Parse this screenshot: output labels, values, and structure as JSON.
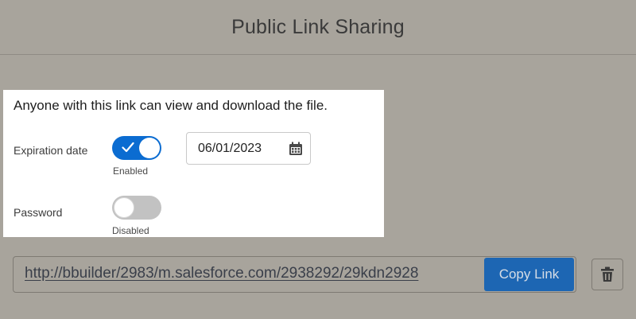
{
  "header": {
    "title": "Public Link Sharing"
  },
  "settings": {
    "intro": "Anyone with this link can view and download the file.",
    "expiration": {
      "label": "Expiration date",
      "enabled": true,
      "status": "Enabled",
      "date": "06/01/2023",
      "icon": "calendar-icon"
    },
    "password": {
      "label": "Password",
      "enabled": false,
      "status": "Disabled"
    }
  },
  "link": {
    "url": "http://bbuilder/2983/m.salesforce.com/2938292/29kdn2928",
    "copy_label": "Copy Link",
    "delete_icon": "trash-icon"
  },
  "colors": {
    "accent": "#0b6cd1",
    "button": "#1d66b3",
    "overlay": "#a8a49c"
  }
}
